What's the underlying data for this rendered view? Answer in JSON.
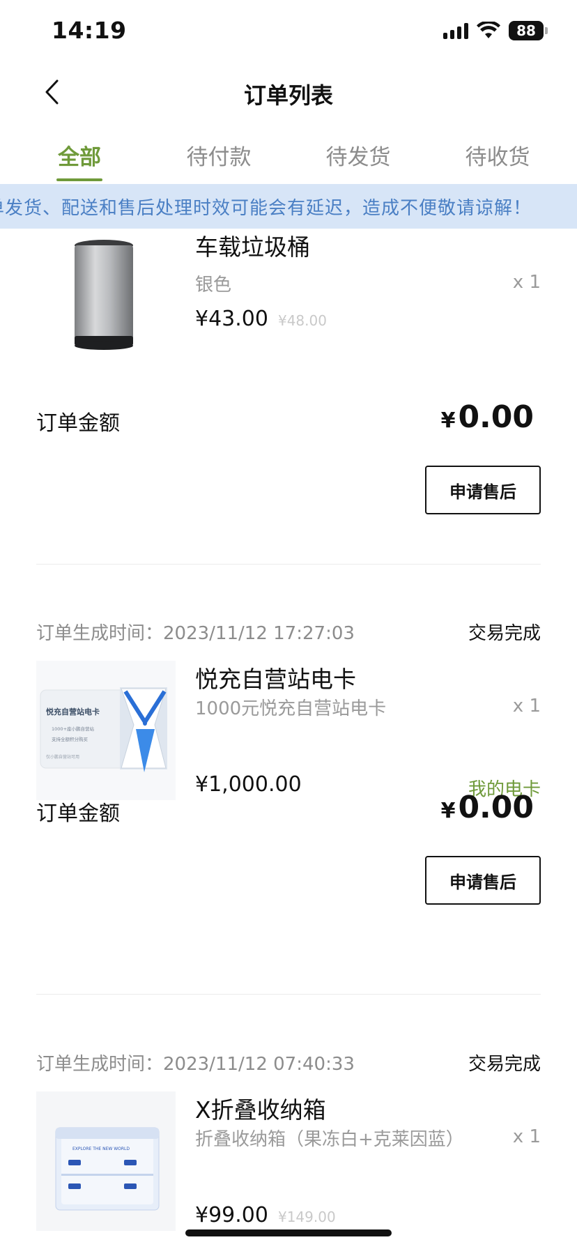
{
  "status_bar": {
    "time": "14:19",
    "battery": "88"
  },
  "nav": {
    "title": "订单列表"
  },
  "tabs": [
    {
      "label": "全部",
      "active": true
    },
    {
      "label": "待付款",
      "active": false
    },
    {
      "label": "待发货",
      "active": false
    },
    {
      "label": "待收货",
      "active": false
    }
  ],
  "notice": {
    "text": "单发货、配送和售后处理时效可能会有延迟，造成不便敬请谅解！"
  },
  "orders": [
    {
      "time_label": "",
      "time": "",
      "status": "",
      "product": {
        "name": "车载垃圾桶",
        "spec": "银色",
        "qty": "x 1",
        "price": "¥43.00",
        "original_price": "¥48.00",
        "link": ""
      },
      "total_label": "订单金额",
      "total_symbol": "¥",
      "total_amount": "0.00",
      "after_sale_label": "申请售后"
    },
    {
      "time_label": "订单生成时间：",
      "time": "2023/11/12 17:27:03",
      "status": "交易完成",
      "product": {
        "name": "悦充自营站电卡",
        "spec": "1000元悦充自营站电卡",
        "qty": "x 1",
        "price": "¥1,000.00",
        "original_price": "",
        "link": "我的电卡",
        "card_title": "悦充自营站电卡",
        "card_line1": "1000+座小鹏自营站",
        "card_line2": "支持全额积分购买",
        "card_footer": "仅小鹏自营站可用"
      },
      "total_label": "订单金额",
      "total_symbol": "¥",
      "total_amount": "0.00",
      "after_sale_label": "申请售后"
    },
    {
      "time_label": "订单生成时间：",
      "time": "2023/11/12 07:40:33",
      "status": "交易完成",
      "product": {
        "name": "X折叠收纳箱",
        "spec": "折叠收纳箱（果冻白+克莱因蓝）",
        "qty": "x 1",
        "price": "¥99.00",
        "original_price": "¥149.00",
        "link": "",
        "box_text": "EXPLORE THE NEW WORLD"
      }
    }
  ],
  "colors": {
    "accent_green": "#6f9a3a",
    "notice_bg": "#d7e5f7",
    "notice_text": "#4a7fc4"
  }
}
